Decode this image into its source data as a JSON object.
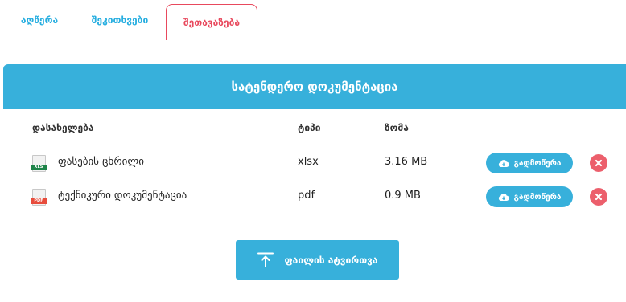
{
  "tabs": [
    {
      "label": "აღწერა"
    },
    {
      "label": "შეკითხვები"
    },
    {
      "label": "შეთავაზება",
      "active": true
    }
  ],
  "panel": {
    "title": "სატენდერო დოკუმენტაცია",
    "columns": {
      "name": "დასახელება",
      "type": "ტიპი",
      "size": "ზომა"
    },
    "files": [
      {
        "name": "ფასების ცხრილი",
        "type": "xlsx",
        "size": "3.16 MB",
        "badge": "XLS",
        "icon": "xls-file-icon"
      },
      {
        "name": "ტექნიკური დოკუმენტაცია",
        "type": "pdf",
        "size": "0.9 MB",
        "badge": "PDF",
        "icon": "pdf-file-icon"
      }
    ],
    "download_label": "გადმოწერა",
    "upload_label": "ფაილის ატვირთვა"
  },
  "colors": {
    "accent": "#37b0db",
    "active_tab": "#e8495d",
    "delete": "#ec5f6c"
  }
}
